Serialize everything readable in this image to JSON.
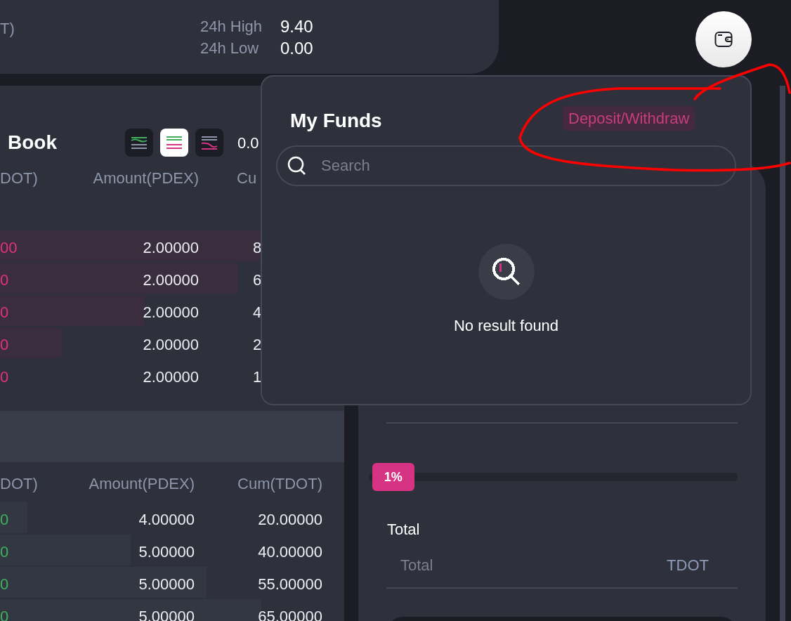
{
  "header": {
    "pair_partial": "T)",
    "stats": [
      {
        "label": "24h High",
        "value": "9.40"
      },
      {
        "label": "24h Low",
        "value": "0.00"
      }
    ]
  },
  "order_book": {
    "title": "Book",
    "views": [
      {
        "kind": "buy",
        "selected": false
      },
      {
        "kind": "all",
        "selected": true
      },
      {
        "kind": "sell",
        "selected": false
      }
    ],
    "precision": "0.0",
    "ask_columns": [
      "DOT)",
      "Amount(PDEX)",
      "Cu"
    ],
    "asks": [
      {
        "price": "00",
        "amount": "2.00000",
        "cum": "8",
        "level": 0.9
      },
      {
        "price": "0",
        "amount": "2.00000",
        "cum": "6",
        "level": 0.69
      },
      {
        "price": "0",
        "amount": "2.00000",
        "cum": "4",
        "level": 0.42
      },
      {
        "price": "0",
        "amount": "2.00000",
        "cum": "2",
        "level": 0.18
      },
      {
        "price": "0",
        "amount": "2.00000",
        "cum": "1"
      }
    ],
    "bid_columns": [
      "DOT)",
      "Amount(PDEX)",
      "Cum(TDOT)"
    ],
    "bids": [
      {
        "price": "0",
        "amount": "4.00000",
        "cum": "20.00000",
        "level": 0.08
      },
      {
        "price": "0",
        "amount": "5.00000",
        "cum": "40.00000",
        "level": 0.38
      },
      {
        "price": "0",
        "amount": "5.00000",
        "cum": "55.00000",
        "level": 0.6
      },
      {
        "price": "0",
        "amount": "5.00000",
        "cum": "65.00000",
        "level": 0.76
      }
    ]
  },
  "order_form": {
    "slider": {
      "level": 0.01,
      "label": "1%"
    },
    "total": {
      "label": "Total",
      "placeholder": "Total",
      "unit": "TDOT"
    }
  },
  "funds_popup": {
    "title": "My Funds",
    "action": "Deposit/Withdraw",
    "search": {
      "placeholder": "Search"
    },
    "empty_message": "No result found"
  }
}
